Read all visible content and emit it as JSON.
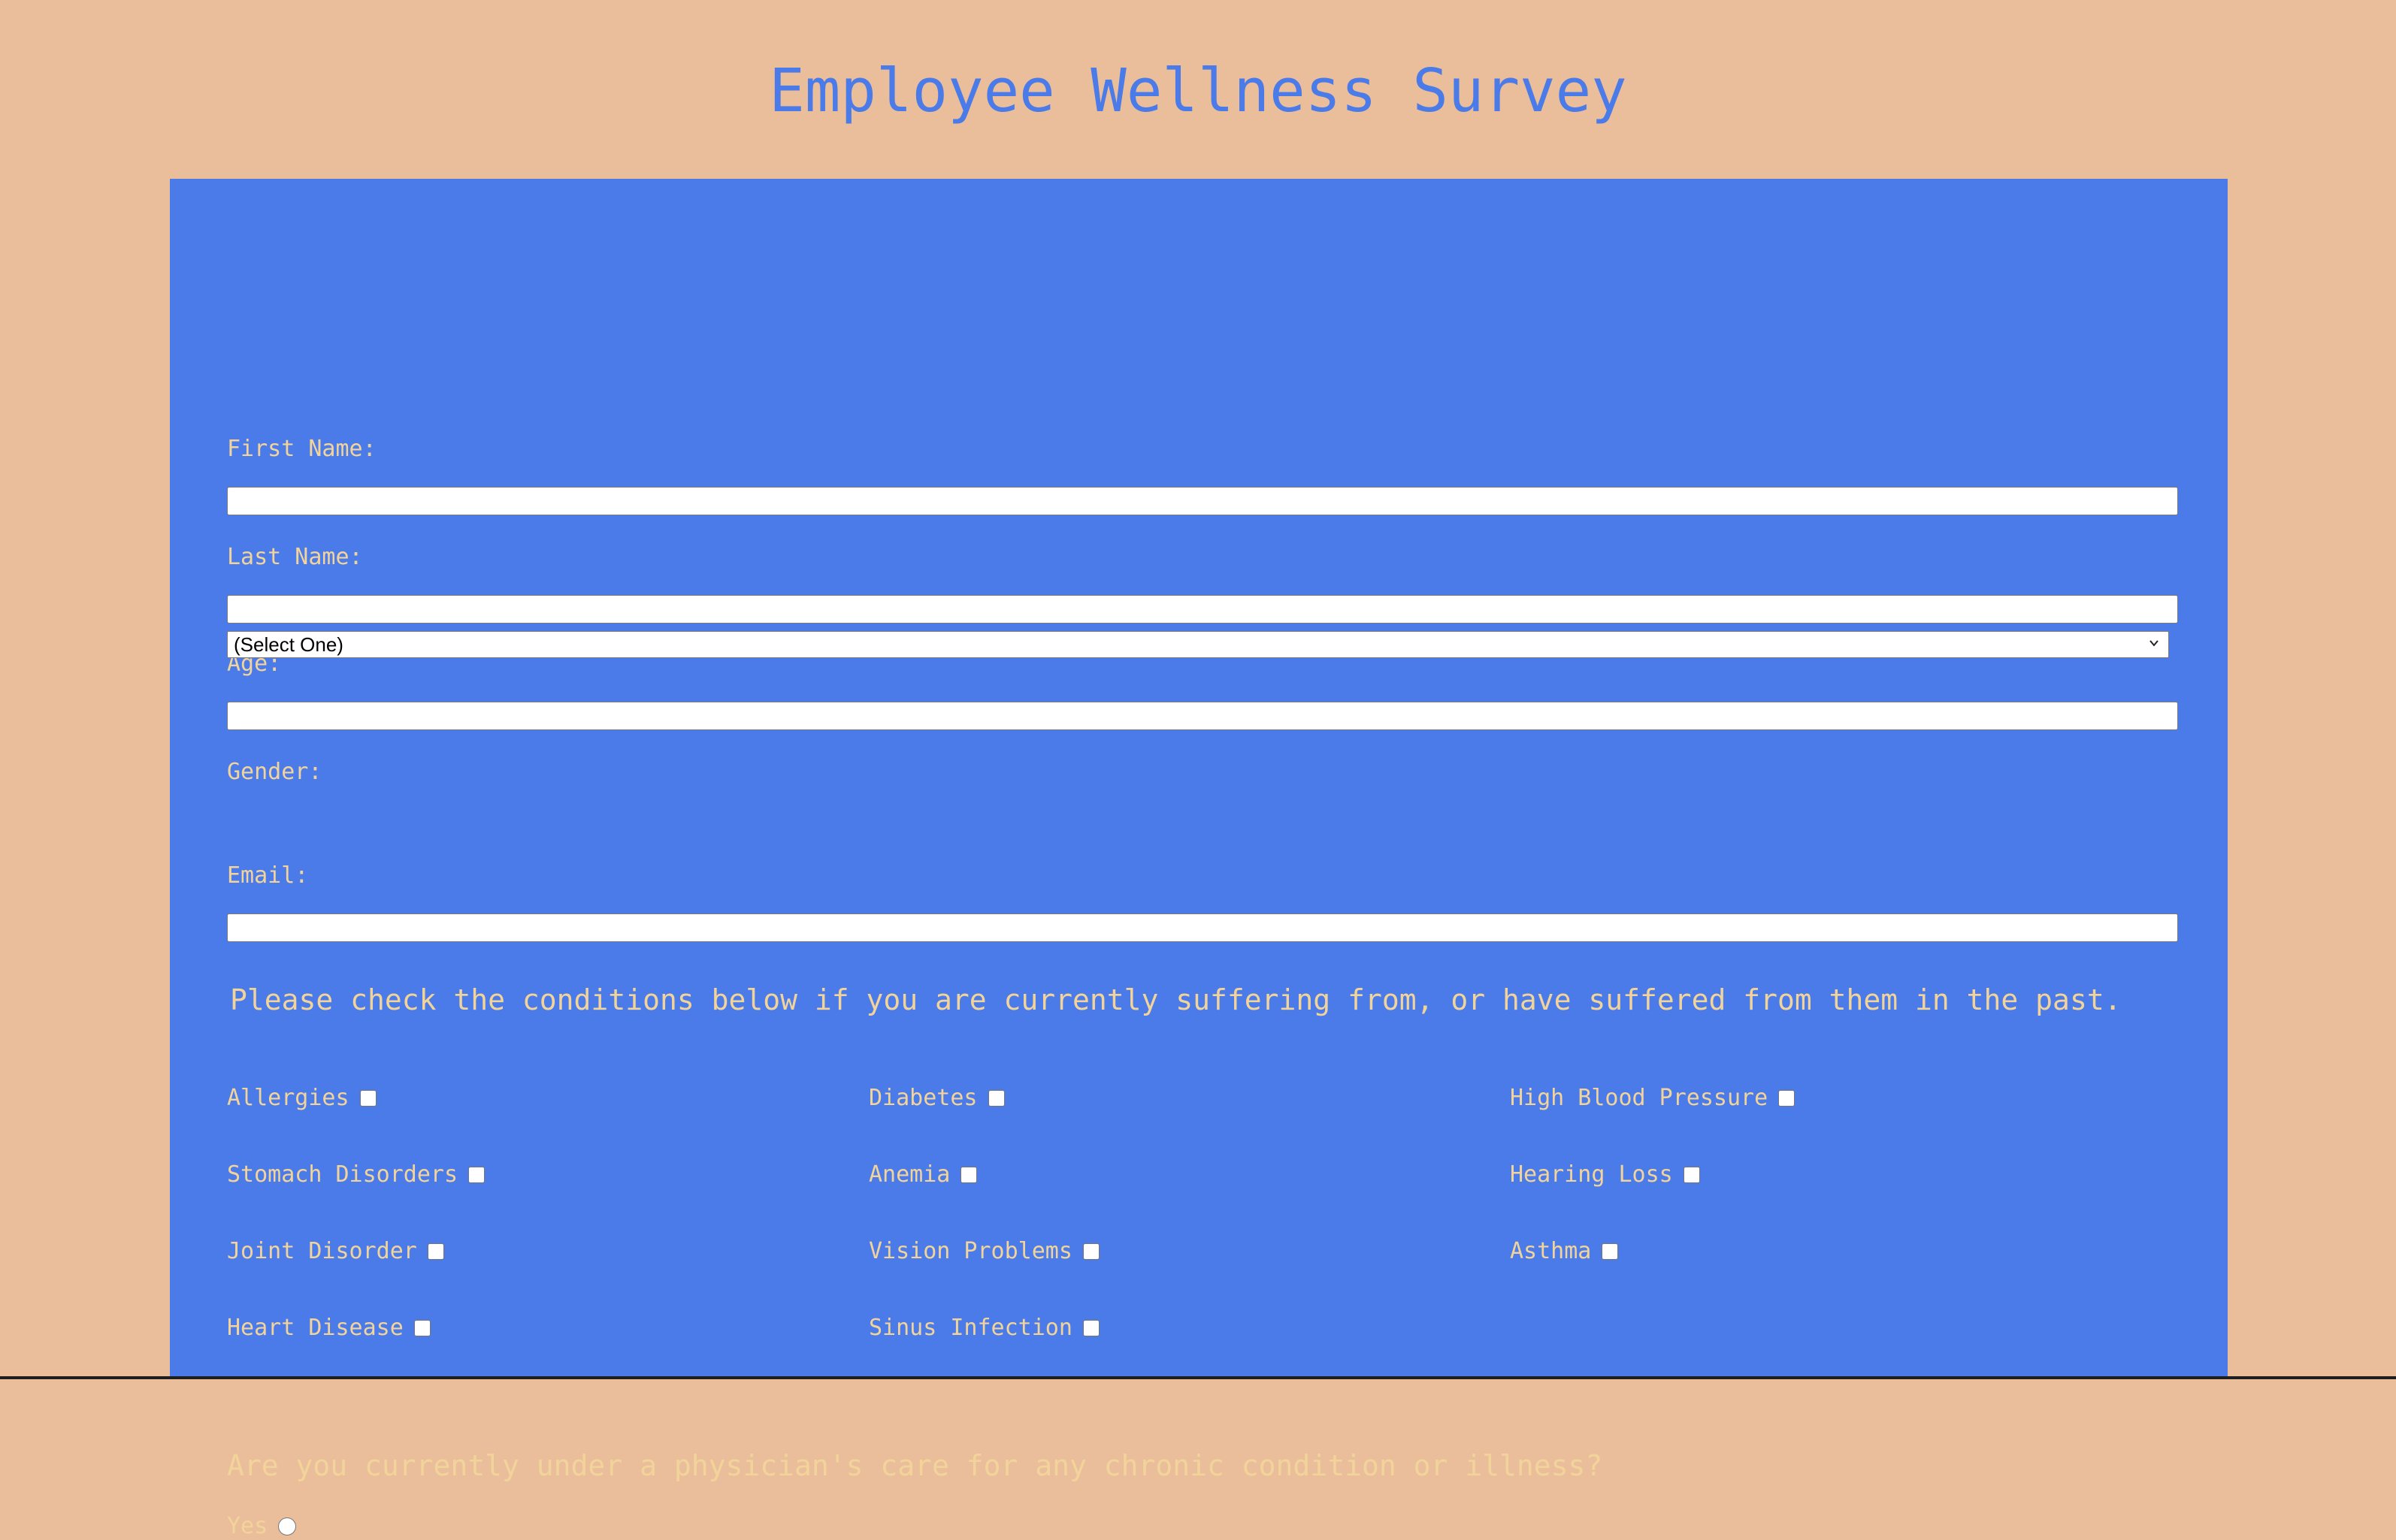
{
  "page": {
    "title": "Employee Wellness Survey"
  },
  "form": {
    "first_name_label": "First Name:",
    "first_name_value": "",
    "last_name_label": "Last Name:",
    "last_name_value": "",
    "age_label": "Age:",
    "age_value": "",
    "gender_label": "Gender:",
    "gender_selected": "(Select One)",
    "email_label": "Email:",
    "email_value": ""
  },
  "conditions": {
    "prompt": "Please check the conditions below if you are currently suffering from, or have suffered from them in the past.",
    "items": [
      {
        "label": "Allergies",
        "checked": false
      },
      {
        "label": "Diabetes",
        "checked": false
      },
      {
        "label": "High Blood Pressure",
        "checked": false
      },
      {
        "label": "Stomach Disorders",
        "checked": false
      },
      {
        "label": "Anemia",
        "checked": false
      },
      {
        "label": "Hearing Loss",
        "checked": false
      },
      {
        "label": "Joint Disorder",
        "checked": false
      },
      {
        "label": "Vision Problems",
        "checked": false
      },
      {
        "label": "Asthma",
        "checked": false
      },
      {
        "label": "Heart Disease",
        "checked": false
      },
      {
        "label": "Sinus Infection",
        "checked": false
      }
    ]
  },
  "physician": {
    "question": "Are you currently under a physician's care for any chronic condition or illness?",
    "yes_label": "Yes",
    "yes_selected": false
  },
  "colors": {
    "page_background": "#EABE9A",
    "panel_background": "#4A7BE9",
    "title_text": "#4A7BE9",
    "label_text": "#F2D49A"
  }
}
